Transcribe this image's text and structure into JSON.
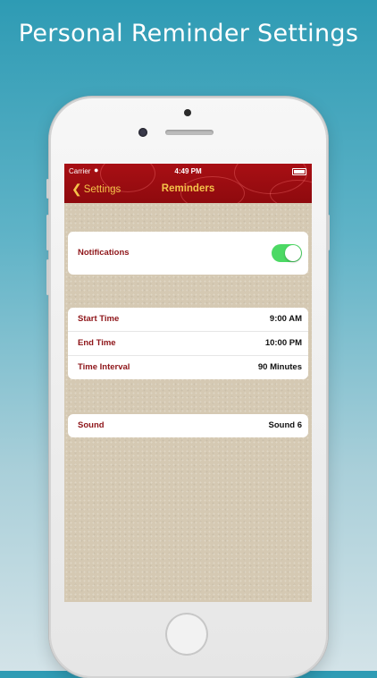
{
  "headline": "Personal Reminder Settings",
  "status_bar": {
    "carrier": "Carrier",
    "time": "4:49 PM"
  },
  "nav": {
    "back_label": "Settings",
    "title": "Reminders"
  },
  "notifications": {
    "label": "Notifications",
    "enabled": true
  },
  "schedule": [
    {
      "label": "Start Time",
      "value": "9:00 AM"
    },
    {
      "label": "End Time",
      "value": "10:00 PM"
    },
    {
      "label": "Time Interval",
      "value": "90 Minutes"
    }
  ],
  "sound": {
    "label": "Sound",
    "value": "Sound 6"
  },
  "colors": {
    "nav_bar": "#a80f14",
    "nav_text": "#f5c34a",
    "label_text": "#8e1519",
    "toggle_on": "#4cd964"
  },
  "icons": [
    "wifi-icon",
    "battery-icon",
    "chevron-left-icon"
  ]
}
